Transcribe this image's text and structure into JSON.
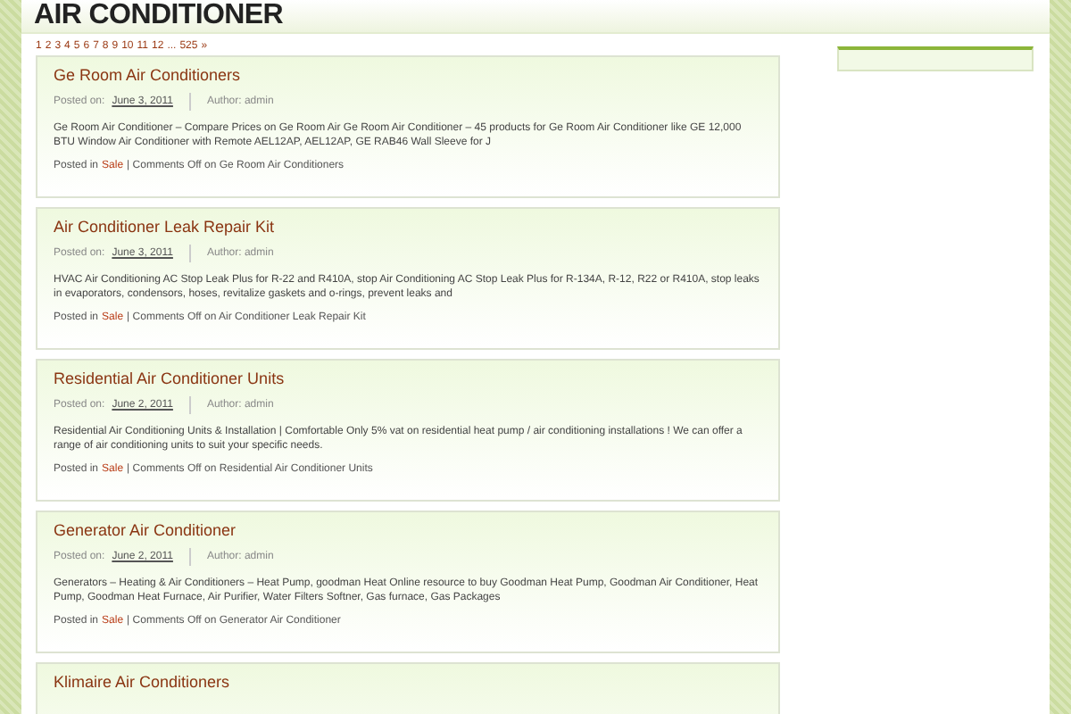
{
  "site_title": "AIR CONDITIONER",
  "pagination": [
    "1",
    "2",
    "3",
    "4",
    "5",
    "6",
    "7",
    "8",
    "9",
    "10",
    "11",
    "12",
    "...",
    "525",
    "»"
  ],
  "posts": [
    {
      "title": "Ge Room Air Conditioners",
      "posted_label": "Posted on:",
      "date": "June 3, 2011",
      "author_label": "Author:",
      "author": "admin",
      "excerpt": "Ge Room Air Conditioner – Compare Prices on Ge Room Air Ge Room Air Conditioner – 45 products for Ge Room Air Conditioner like GE 12,000 BTU Window Air Conditioner with Remote AEL12AP, AEL12AP, GE RAB46 Wall Sleeve for J",
      "posted_in": "Posted in",
      "category": "Sale",
      "comments": "| Comments Off on Ge Room Air Conditioners"
    },
    {
      "title": "Air Conditioner Leak Repair Kit",
      "posted_label": "Posted on:",
      "date": "June 3, 2011",
      "author_label": "Author:",
      "author": "admin",
      "excerpt": "HVAC Air Conditioning AC Stop Leak Plus for R-22 and R410A, stop Air Conditioning AC Stop Leak Plus for R-134A, R-12, R22 or R410A, stop leaks in evaporators, condensors, hoses, revitalize gaskets and o-rings, prevent leaks and",
      "posted_in": "Posted in",
      "category": "Sale",
      "comments": "| Comments Off on Air Conditioner Leak Repair Kit"
    },
    {
      "title": "Residential Air Conditioner Units",
      "posted_label": "Posted on:",
      "date": "June 2, 2011",
      "author_label": "Author:",
      "author": "admin",
      "excerpt": "Residential Air Conditioning Units & Installation | Comfortable Only 5% vat on residential heat pump / air conditioning installations ! We can offer a range of air conditioning units to suit your specific needs.",
      "posted_in": "Posted in",
      "category": "Sale",
      "comments": "| Comments Off on Residential Air Conditioner Units"
    },
    {
      "title": "Generator Air Conditioner",
      "posted_label": "Posted on:",
      "date": "June 2, 2011",
      "author_label": "Author:",
      "author": "admin",
      "excerpt": "Generators – Heating & Air Conditioners – Heat Pump, goodman Heat Online resource to buy Goodman Heat Pump, Goodman Air Conditioner, Heat Pump, Goodman Heat Furnace, Air Purifier, Water Filters Softner, Gas furnace, Gas Packages",
      "posted_in": "Posted in",
      "category": "Sale",
      "comments": "| Comments Off on Generator Air Conditioner"
    },
    {
      "title": "Klimaire Air Conditioners"
    }
  ]
}
